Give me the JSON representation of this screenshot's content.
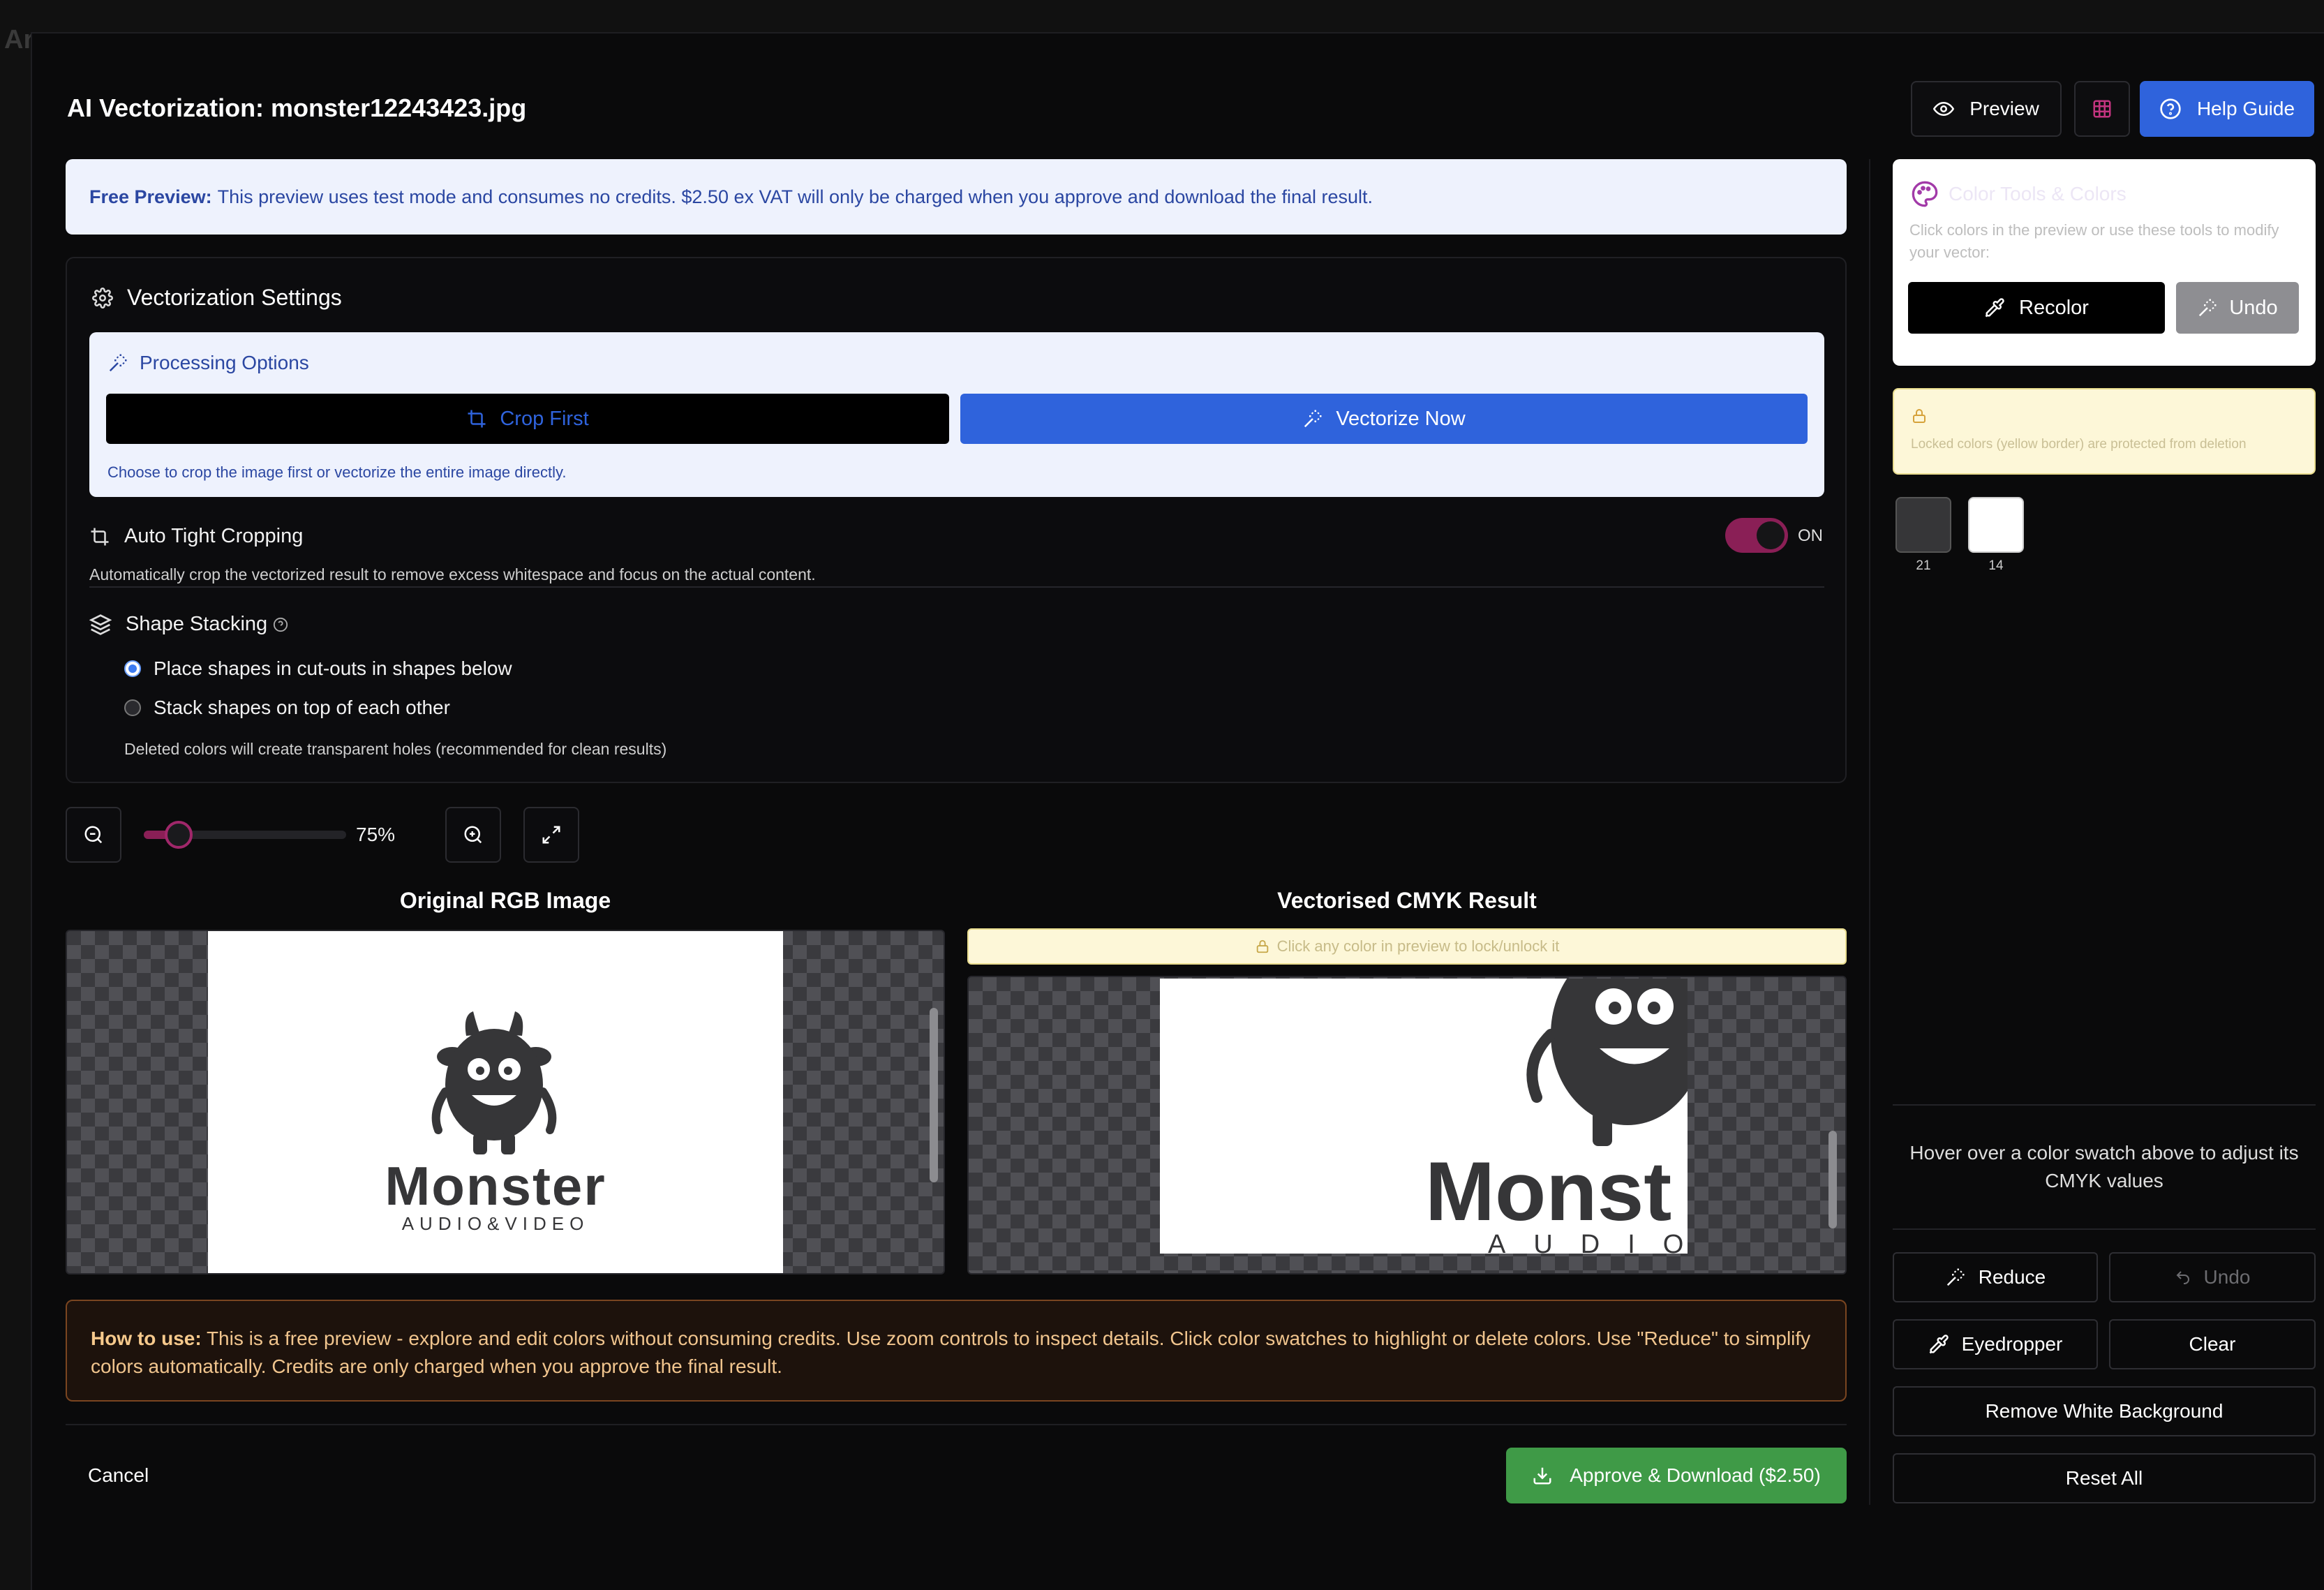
{
  "backdrop": {
    "title": "Ar"
  },
  "modal": {
    "title": "AI Vectorization: monster12243423.jpg",
    "close_glyph": "×",
    "header_buttons": {
      "preview": "Preview",
      "help": "Help Guide"
    }
  },
  "notice": {
    "bold": "Free Preview:",
    "text": "This preview uses test mode and consumes no credits. $2.50 ex VAT will only be charged when you approve and download the final result."
  },
  "settings": {
    "title": "Vectorization Settings",
    "processing": {
      "title": "Processing Options",
      "crop_first": "Crop First",
      "vectorize_now": "Vectorize Now",
      "hint": "Choose to crop the image first or vectorize the entire image directly."
    },
    "auto_crop": {
      "label": "Auto Tight Cropping",
      "state": "ON",
      "description": "Automatically crop the vectorized result to remove excess whitespace and focus on the actual content."
    },
    "stacking": {
      "label": "Shape Stacking",
      "options": [
        "Place shapes in cut-outs in shapes below",
        "Stack shapes on top of each other"
      ],
      "selected": 0,
      "note": "Deleted colors will create transparent holes (recommended for clean results)"
    }
  },
  "zoom": {
    "value": "75%",
    "level": 0.12
  },
  "original": {
    "title": "Original RGB Image",
    "logo_word": "Monster",
    "logo_sub": "AUDIO&VIDEO"
  },
  "result": {
    "title": "Vectorised CMYK Result",
    "lock_hint": "Click any color in preview to lock/unlock it",
    "logo_word": "Monst",
    "logo_sub": "AUDIO&VIDEO"
  },
  "howto": {
    "bold": "How to use:",
    "text": "This is a free preview - explore and edit colors without consuming credits. Use zoom controls to inspect details. Click color swatches to highlight or delete colors. Use \"Reduce\" to simplify colors automatically. Credits are only charged when you approve the final result."
  },
  "footer": {
    "cancel": "Cancel",
    "approve": "Approve & Download ($2.50)"
  },
  "sidebar": {
    "tools_title": "Color Tools & Colors",
    "tools_desc": "Click colors in the preview or use these tools to modify your vector:",
    "recolor": "Recolor",
    "undo": "Undo",
    "lock_note": "Locked colors (yellow border) are protected from deletion",
    "swatches": [
      {
        "color": "#363638",
        "count": "21"
      },
      {
        "color": "#ffffff",
        "count": "14"
      }
    ],
    "cmyk_hint": "Hover over a color swatch above to adjust its CMYK values",
    "buttons": {
      "reduce": "Reduce",
      "undo": "Undo",
      "eyedropper": "Eyedropper",
      "clear": "Clear",
      "remove_white": "Remove White Background",
      "reset_all": "Reset All"
    }
  },
  "colors": {
    "accent_blue": "#2f63dc",
    "toggle_magenta": "#8a1f56",
    "approve_green": "#3f9a47"
  }
}
